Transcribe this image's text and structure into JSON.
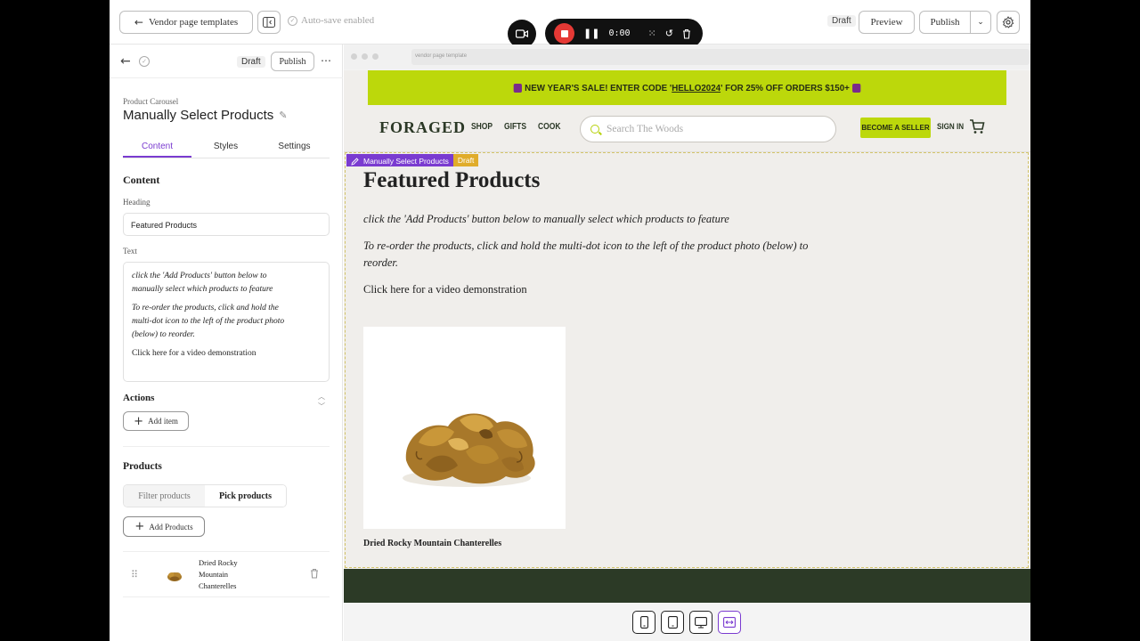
{
  "topbar": {
    "back_label": "Vendor page templates",
    "autosave": "Auto-save enabled",
    "status": "Draft",
    "preview": "Preview",
    "publish": "Publish"
  },
  "recorder": {
    "time": "0:00"
  },
  "panel": {
    "draft": "Draft",
    "publish": "Publish",
    "component_type": "Product Carousel",
    "component_title": "Manually Select Products",
    "tabs": [
      "Content",
      "Styles",
      "Settings"
    ],
    "content_heading": "Content",
    "heading_label": "Heading",
    "heading_value": "Featured Products",
    "text_label": "Text",
    "text_lines": [
      "click the 'Add Products' button below to manually select which products to feature",
      "To re-order the products, click and hold the multi-dot icon to the left of the product photo (below) to reorder.",
      "Click here for a video demonstration"
    ],
    "actions_heading": "Actions",
    "add_item": "Add item",
    "products_heading": "Products",
    "segment": [
      "Filter products",
      "Pick products"
    ],
    "add_products": "Add Products",
    "product_item": "Dried Rocky Mountain Chanterelles"
  },
  "preview": {
    "url": "vendor page template",
    "promo_before": "NEW YEAR'S SALE! ENTER CODE '",
    "promo_code": "HELLO2024",
    "promo_after": "' FOR 25% OFF ORDERS $150+",
    "logo": "FORAGED",
    "nav": [
      "SHOP",
      "GIFTS",
      "COOK"
    ],
    "search_placeholder": "Search The Woods",
    "become_seller": "BECOME A SELLER",
    "sign_in": "SIGN IN",
    "selection_label": "Manually Select Products",
    "selection_status": "Draft",
    "title": "Featured Products",
    "p1": "click the 'Add Products' button below to manually select which products to feature",
    "p2": "To re-order the products, click and hold the multi-dot icon to the left of the product photo (below) to reorder.",
    "p3": "Click here for a video demonstration",
    "product_name": "Dried Rocky Mountain Chanterelles"
  },
  "colors": {
    "accent": "#7a3bd0",
    "promo_bg": "#bcd80b",
    "footer_bg": "#2c3a26",
    "record_red": "#e53935"
  }
}
